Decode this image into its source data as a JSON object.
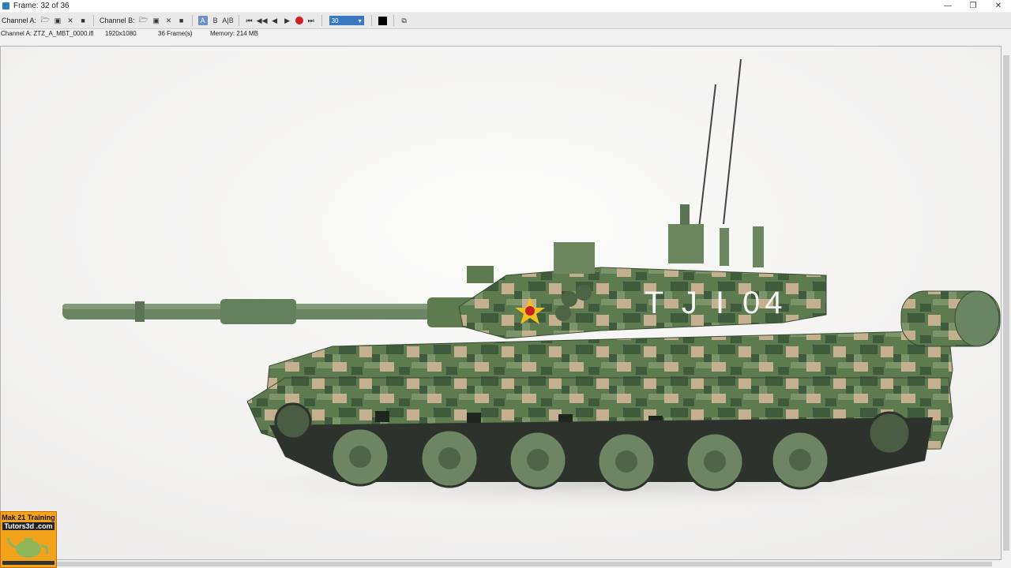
{
  "window": {
    "title": "Frame: 32 of 36",
    "controls": [
      "minimize-icon",
      "restore-icon",
      "close-icon"
    ]
  },
  "toolbar": {
    "channel_a_label": "Channel A:",
    "channel_b_label": "Channel B:",
    "channel_a_icons": [
      "open-folder-icon",
      "load-icon",
      "clear-icon",
      "save-icon"
    ],
    "channel_b_icons": [
      "open-folder-icon",
      "load-icon",
      "clear-icon",
      "save-icon"
    ],
    "ab_buttons": [
      "A",
      "B",
      "A|B"
    ],
    "playback_icons": [
      "go-to-start-icon",
      "step-back-icon",
      "play-reverse-icon",
      "play-icon",
      "record-icon",
      "go-to-end-icon"
    ],
    "frame_value": "30",
    "swatch_color": "#000000"
  },
  "info": {
    "file": "Channel A: ZTZ_A_MBT_0000.ifl",
    "resolution": "1920x1080",
    "frames": "36 Frame(s)",
    "memory": "Memory: 214 MB"
  },
  "viewport": {
    "tank_marking": "T J I 04"
  },
  "watermark": {
    "line1": "Mak 21 Training",
    "line2": "Tutors3d .com"
  },
  "colors": {
    "accent": "#3a78c2",
    "active_button": "#6a8fc9",
    "record": "#d02020",
    "camo_green": "#5e7a4f",
    "camo_tan": "#c4b08e",
    "camo_dark": "#3f5a3c"
  }
}
